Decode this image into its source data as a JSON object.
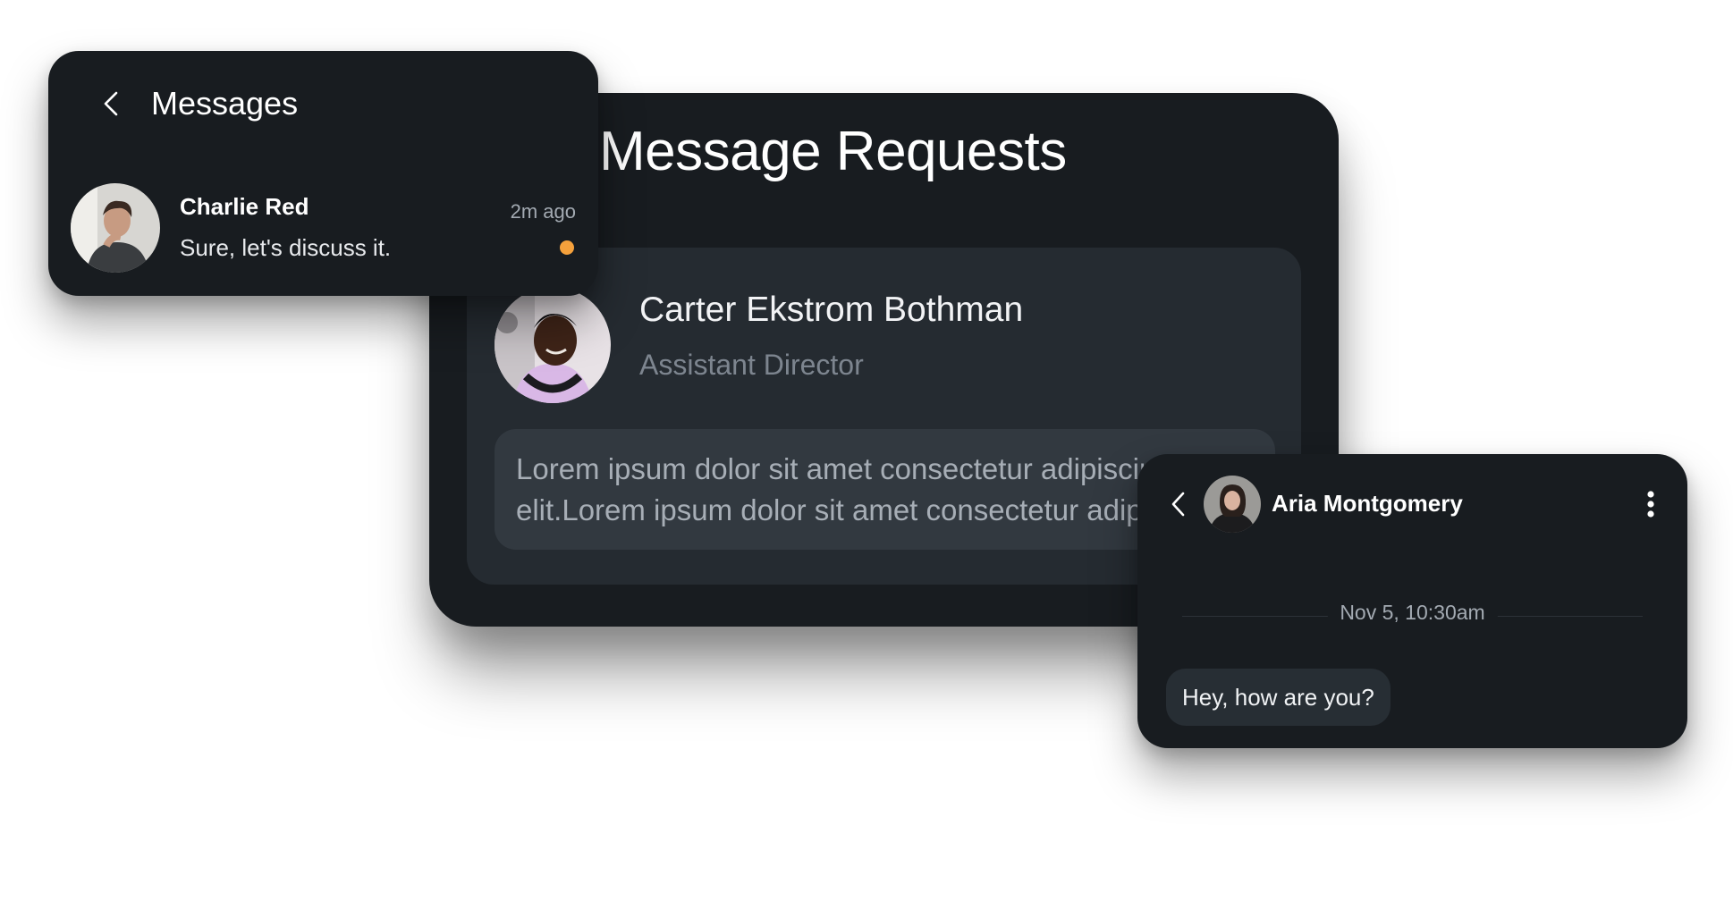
{
  "requests": {
    "title": "Message Requests",
    "sender_name": "Carter Ekstrom Bothman",
    "sender_role": "Assistant Director",
    "message_line1": "Lorem ipsum dolor sit amet consectetur adipiscing",
    "message_line2": "elit.Lorem ipsum dolor sit amet consectetur adipiscing"
  },
  "messages": {
    "title": "Messages",
    "chat": {
      "name": "Charlie Red",
      "preview": "Sure, let's discuss it.",
      "time": "2m ago",
      "unread_color": "#f5a13c"
    }
  },
  "conversation": {
    "contact_name": "Aria Montgomery",
    "date_separator": "Nov 5, 10:30am",
    "messages": [
      {
        "text": "Hey, how are you?"
      }
    ]
  },
  "icons": [
    "back-icon",
    "more-vertical-icon"
  ],
  "colors": {
    "card_bg": "#181c20",
    "panel_bg": "#252b31",
    "accent_dot": "#f5a13c"
  }
}
